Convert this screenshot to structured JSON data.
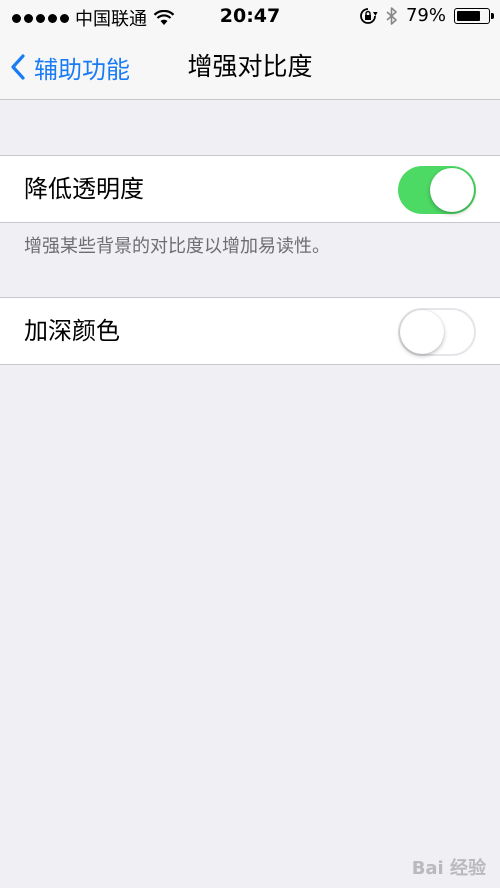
{
  "status_bar": {
    "carrier": "中国联通",
    "time": "20:47",
    "battery": "79%",
    "battery_level": 0.79
  },
  "nav": {
    "back_label": "辅助功能",
    "title": "增强对比度"
  },
  "settings": {
    "reduce_transparency": {
      "label": "降低透明度",
      "enabled": true
    },
    "footer": "增强某些背景的对比度以增加易读性。",
    "darken_colors": {
      "label": "加深颜色",
      "enabled": false
    }
  },
  "colors": {
    "accent": "#1a7cf5",
    "toggle_on": "#4cd964",
    "background": "#efeff4"
  },
  "watermark": "Bai 经验"
}
